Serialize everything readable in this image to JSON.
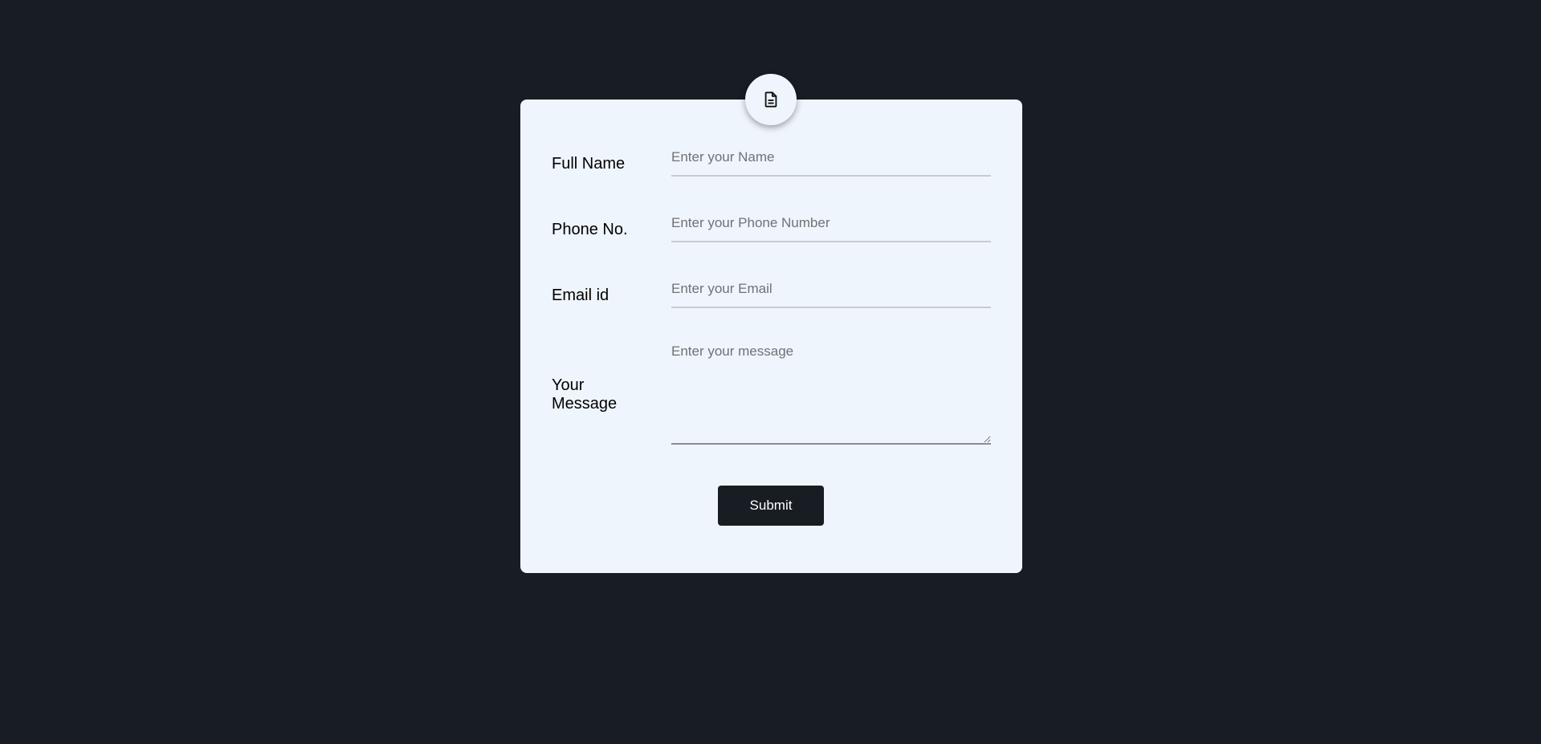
{
  "badge": {
    "icon": "document-icon"
  },
  "form": {
    "full_name": {
      "label": "Full Name",
      "placeholder": "Enter your Name",
      "value": ""
    },
    "phone": {
      "label": "Phone No.",
      "placeholder": "Enter your Phone Number",
      "value": ""
    },
    "email": {
      "label": "Email id",
      "placeholder": "Enter your Email",
      "value": ""
    },
    "message": {
      "label": "Your Message",
      "placeholder": "Enter your message",
      "value": ""
    },
    "submit_label": "Submit"
  },
  "colors": {
    "background": "#181c23",
    "card": "#eff5fc",
    "button": "#181c23",
    "button_text": "#ffffff"
  }
}
